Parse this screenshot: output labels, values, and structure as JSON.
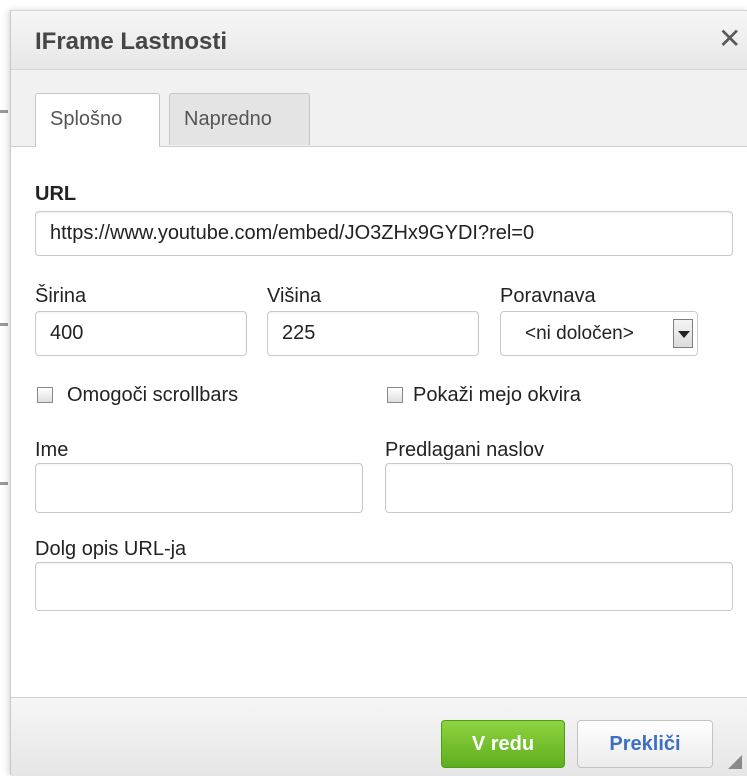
{
  "dialog": {
    "title": "IFrame Lastnosti",
    "close_glyph": "✕"
  },
  "tabs": [
    {
      "label": "Splošno",
      "active": true
    },
    {
      "label": "Napredno",
      "active": false
    }
  ],
  "fields": {
    "url": {
      "label": "URL",
      "value": "https://www.youtube.com/embed/JO3ZHx9GYDI?rel=0"
    },
    "width": {
      "label": "Širina",
      "value": "400"
    },
    "height": {
      "label": "Višina",
      "value": "225"
    },
    "align": {
      "label": "Poravnava",
      "selected": "<ni določen>"
    },
    "scrollbars": {
      "label": "Omogoči scrollbars",
      "checked": false
    },
    "frame_border": {
      "label": "Pokaži mejo okvira",
      "checked": false
    },
    "name": {
      "label": "Ime",
      "value": ""
    },
    "advisory_title": {
      "label": "Predlagani naslov",
      "value": ""
    },
    "long_desc": {
      "label": "Dolg opis URL-ja",
      "value": ""
    }
  },
  "buttons": {
    "ok": "V redu",
    "cancel": "Prekliči"
  },
  "colors": {
    "ok_button": "#6dbd27",
    "cancel_text": "#3e6fc4"
  },
  "icons": {
    "close": "close-icon",
    "dropdown": "chevron-down-icon",
    "resize": "resize-grip-icon"
  }
}
